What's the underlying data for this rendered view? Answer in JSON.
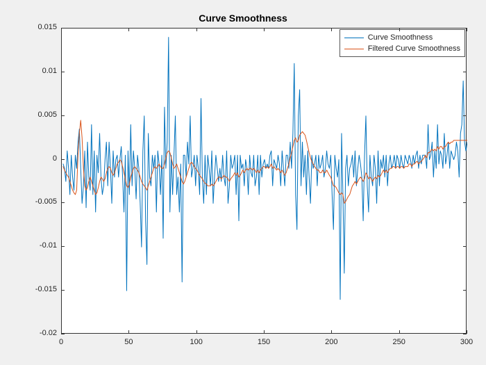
{
  "chart_data": {
    "type": "line",
    "title": "Curve Smoothness",
    "xlabel": "",
    "ylabel": "",
    "xlim": [
      0,
      300
    ],
    "ylim": [
      -0.02,
      0.015
    ],
    "xticks": [
      0,
      50,
      100,
      150,
      200,
      250,
      300
    ],
    "yticks": [
      -0.02,
      -0.015,
      -0.01,
      -0.005,
      0,
      0.005,
      0.01,
      0.015
    ],
    "ytick_labels": [
      "-0.02",
      "-0.015",
      "-0.01",
      "-0.005",
      "0",
      "0.005",
      "0.01",
      "0.015"
    ],
    "legend": {
      "position": "northeast",
      "entries": [
        "Curve Smoothness",
        "Filtered Curve Smoothness"
      ]
    },
    "colors": {
      "series1": "#0072BD",
      "series2": "#D95319"
    },
    "series": [
      {
        "name": "Curve Smoothness",
        "color": "#0072BD",
        "x_start": 1,
        "x_step": 1,
        "values": [
          -0.0005,
          -0.001,
          -0.0025,
          0.001,
          -0.001,
          -0.004,
          0.0005,
          -0.002,
          -0.0035,
          0.0005,
          -0.001,
          0.002,
          0.0035,
          -0.001,
          -0.005,
          -0.003,
          0.001,
          -0.0055,
          0.002,
          -0.002,
          -0.0035,
          0.004,
          -0.004,
          0.001,
          -0.006,
          0.0005,
          -0.0015,
          0.003,
          -0.002,
          -0.004,
          -0.003,
          0.0,
          0.002,
          -0.003,
          0.002,
          -0.001,
          -0.005,
          0.001,
          -0.002,
          0.0,
          0.0005,
          -0.002,
          0.0,
          0.0015,
          -0.002,
          -0.006,
          0.0005,
          -0.015,
          0.001,
          -0.004,
          0.004,
          -0.003,
          0.001,
          -0.001,
          -0.0045,
          0.0005,
          -0.001,
          -0.005,
          -0.01,
          0.001,
          0.005,
          -0.007,
          -0.012,
          0.003,
          -0.002,
          -0.003,
          0.0005,
          -0.001,
          0.0005,
          -0.006,
          0.001,
          -0.0005,
          -0.004,
          0.0005,
          -0.009,
          0.006,
          -0.001,
          0.002,
          0.014,
          -0.006,
          0.0005,
          -0.004,
          0.0005,
          0.005,
          -0.004,
          -0.002,
          -0.006,
          -0.0005,
          -0.014,
          0.0005,
          0.0005,
          -0.002,
          0.002,
          -0.0005,
          0.005,
          -0.002,
          -0.001,
          0.0005,
          -0.003,
          0.0005,
          -0.001,
          -0.004,
          0.007,
          -0.002,
          -0.005,
          0.0005,
          -0.004,
          0.0005,
          -0.001,
          -0.003,
          0.001,
          -0.005,
          -0.002,
          0.0005,
          -0.001,
          -0.0025,
          -0.001,
          -0.0025,
          0.0005,
          -0.002,
          -0.003,
          0.001,
          -0.005,
          -0.003,
          0.0005,
          -0.001,
          -0.0005,
          0.0005,
          -0.004,
          0.0005,
          -0.007,
          0.0005,
          -0.001,
          -0.0005,
          -0.003,
          0.0,
          -0.001,
          -0.004,
          0.0005,
          -0.0015,
          -0.002,
          0.0005,
          -0.003,
          -0.002,
          0.0005,
          -0.004,
          0.0005,
          -0.002,
          -0.0005,
          0.0,
          -0.001,
          -0.0005,
          -0.001,
          0.0005,
          0.001,
          -0.003,
          0.0,
          -0.0005,
          -0.001,
          0.0005,
          -0.0005,
          -0.003,
          0.001,
          -0.001,
          -0.003,
          0.0005,
          0.0005,
          -0.001,
          0.002,
          -0.001,
          0.003,
          0.011,
          -0.004,
          -0.008,
          0.005,
          0.008,
          -0.003,
          0.002,
          -0.002,
          0.0005,
          -0.004,
          0.001,
          -0.002,
          -0.005,
          0.0005,
          -0.001,
          -0.0005,
          0.0005,
          -0.003,
          0.0005,
          -0.001,
          -0.0005,
          0.0005,
          -0.002,
          -0.001,
          0.001,
          -0.0005,
          -0.001,
          0.0005,
          -0.004,
          -0.008,
          0.0005,
          -0.001,
          -0.002,
          0.0,
          -0.016,
          0.003,
          -0.004,
          -0.013,
          -0.001,
          0.0005,
          -0.003,
          -0.001,
          -0.0005,
          0.0005,
          -0.002,
          0.001,
          -0.003,
          -0.001,
          0.0005,
          -0.0005,
          -0.002,
          -0.007,
          0.0005,
          0.005,
          -0.003,
          -0.006,
          0.0005,
          -0.002,
          -0.003,
          0.0005,
          -0.001,
          -0.005,
          0.001,
          -0.003,
          0.0,
          -0.001,
          0.0005,
          -0.002,
          0.0005,
          -0.003,
          -0.0005,
          0.0005,
          -0.001,
          -0.0005,
          0.0005,
          -0.001,
          0.0005,
          0.0,
          -0.001,
          0.0005,
          -0.0005,
          -0.001,
          0.0005,
          0.0,
          -0.0005,
          0.0005,
          0.0,
          -0.001,
          0.0005,
          -0.0005,
          0.0005,
          0.001,
          -0.001,
          0.0005,
          -0.0005,
          0.0005,
          0.0005,
          0.0005,
          -0.001,
          0.004,
          0.0,
          0.0005,
          0.002,
          -0.002,
          0.001,
          -0.001,
          0.004,
          -0.0005,
          0.001,
          0.0005,
          -0.001,
          0.003,
          -0.0005,
          0.0005,
          0.002,
          -0.001,
          0.001,
          0.0005,
          0.0,
          0.0005,
          0.002,
          0.001,
          -0.002,
          0.003,
          0.004,
          0.009,
          0.002,
          0.001,
          0.002
        ]
      },
      {
        "name": "Filtered Curve Smoothness",
        "color": "#D95319",
        "x_start": 1,
        "x_step": 1,
        "values": [
          -0.0008,
          -0.0012,
          -0.0015,
          -0.0018,
          -0.002,
          -0.0025,
          -0.003,
          -0.0035,
          -0.0038,
          -0.004,
          -0.0035,
          0.0005,
          0.003,
          0.0045,
          0.0025,
          -0.001,
          -0.003,
          -0.0035,
          -0.0032,
          -0.0025,
          -0.002,
          -0.0025,
          -0.003,
          -0.0035,
          -0.004,
          -0.0038,
          -0.0032,
          -0.0025,
          -0.002,
          -0.0022,
          -0.0025,
          -0.0022,
          -0.0015,
          -0.001,
          -0.0008,
          -0.001,
          -0.0015,
          -0.0018,
          -0.0015,
          -0.001,
          -0.0005,
          -0.0003,
          0.0,
          -0.0002,
          -0.0008,
          -0.0015,
          -0.0022,
          -0.003,
          -0.0032,
          -0.0028,
          -0.002,
          -0.0015,
          -0.001,
          -0.0008,
          -0.001,
          -0.0012,
          -0.0015,
          -0.002,
          -0.0025,
          -0.0028,
          -0.003,
          -0.0032,
          -0.0035,
          -0.003,
          -0.0025,
          -0.002,
          -0.0015,
          -0.001,
          -0.0008,
          -0.001,
          -0.0008,
          -0.0005,
          -0.0008,
          -0.001,
          -0.001,
          -0.0005,
          0.0002,
          0.0008,
          0.001,
          0.0008,
          0.0002,
          -0.0005,
          -0.001,
          -0.0008,
          -0.0005,
          -0.001,
          -0.0015,
          -0.002,
          -0.0025,
          -0.0028,
          -0.0025,
          -0.002,
          -0.0015,
          -0.001,
          -0.0005,
          -0.0003,
          -0.0005,
          -0.0008,
          -0.001,
          -0.0012,
          -0.0015,
          -0.0018,
          -0.002,
          -0.0022,
          -0.0025,
          -0.0027,
          -0.0028,
          -0.003,
          -0.003,
          -0.003,
          -0.0028,
          -0.003,
          -0.0028,
          -0.0025,
          -0.0022,
          -0.002,
          -0.002,
          -0.0022,
          -0.002,
          -0.0018,
          -0.002,
          -0.002,
          -0.0022,
          -0.0025,
          -0.0022,
          -0.002,
          -0.0018,
          -0.0015,
          -0.0018,
          -0.0015,
          -0.002,
          -0.0018,
          -0.0015,
          -0.0012,
          -0.0015,
          -0.0012,
          -0.001,
          -0.0012,
          -0.001,
          -0.001,
          -0.0012,
          -0.001,
          -0.0012,
          -0.0015,
          -0.0012,
          -0.0015,
          -0.0012,
          -0.001,
          -0.0008,
          -0.0008,
          -0.001,
          -0.0008,
          -0.001,
          -0.0008,
          -0.0005,
          -0.001,
          -0.0008,
          -0.001,
          -0.0012,
          -0.001,
          -0.0012,
          -0.0015,
          -0.0012,
          -0.0015,
          -0.0018,
          -0.0015,
          -0.001,
          -0.0005,
          0.0002,
          0.0008,
          0.0015,
          0.0022,
          0.0025,
          0.002,
          0.0022,
          0.0028,
          0.003,
          0.0032,
          0.003,
          0.0028,
          0.0022,
          0.0015,
          0.0008,
          0.0002,
          -0.0002,
          -0.0005,
          -0.0008,
          -0.001,
          -0.0012,
          -0.0012,
          -0.0015,
          -0.0015,
          -0.0012,
          -0.0015,
          -0.0015,
          -0.0012,
          -0.0015,
          -0.0018,
          -0.002,
          -0.0025,
          -0.003,
          -0.003,
          -0.0032,
          -0.0035,
          -0.0038,
          -0.004,
          -0.0038,
          -0.004,
          -0.005,
          -0.0048,
          -0.0045,
          -0.0042,
          -0.004,
          -0.0035,
          -0.003,
          -0.0028,
          -0.0025,
          -0.0028,
          -0.0025,
          -0.0022,
          -0.002,
          -0.0022,
          -0.0025,
          -0.0022,
          -0.0015,
          -0.0018,
          -0.0022,
          -0.002,
          -0.0022,
          -0.0025,
          -0.0022,
          -0.002,
          -0.0022,
          -0.0018,
          -0.002,
          -0.0018,
          -0.0015,
          -0.0012,
          -0.0015,
          -0.0012,
          -0.0015,
          -0.0012,
          -0.001,
          -0.001,
          -0.0008,
          -0.0008,
          -0.001,
          -0.0008,
          -0.0008,
          -0.001,
          -0.0008,
          -0.0008,
          -0.001,
          -0.0008,
          -0.0008,
          -0.0008,
          -0.0005,
          -0.0005,
          -0.0008,
          -0.0005,
          -0.0005,
          -0.0003,
          -0.0002,
          -0.0005,
          -0.0003,
          -0.0002,
          0.0,
          0.0002,
          0.0005,
          0.0002,
          0.0008,
          0.0008,
          0.001,
          0.0012,
          0.001,
          0.0012,
          0.001,
          0.0015,
          0.0012,
          0.0015,
          0.0015,
          0.0012,
          0.0015,
          0.0015,
          0.0018,
          0.002,
          0.0018,
          0.002,
          0.002,
          0.0022,
          0.0022,
          0.0022,
          0.0022,
          0.0022,
          0.0022,
          0.0022,
          0.0022,
          0.0022,
          0.0022,
          0.0022
        ]
      }
    ]
  }
}
